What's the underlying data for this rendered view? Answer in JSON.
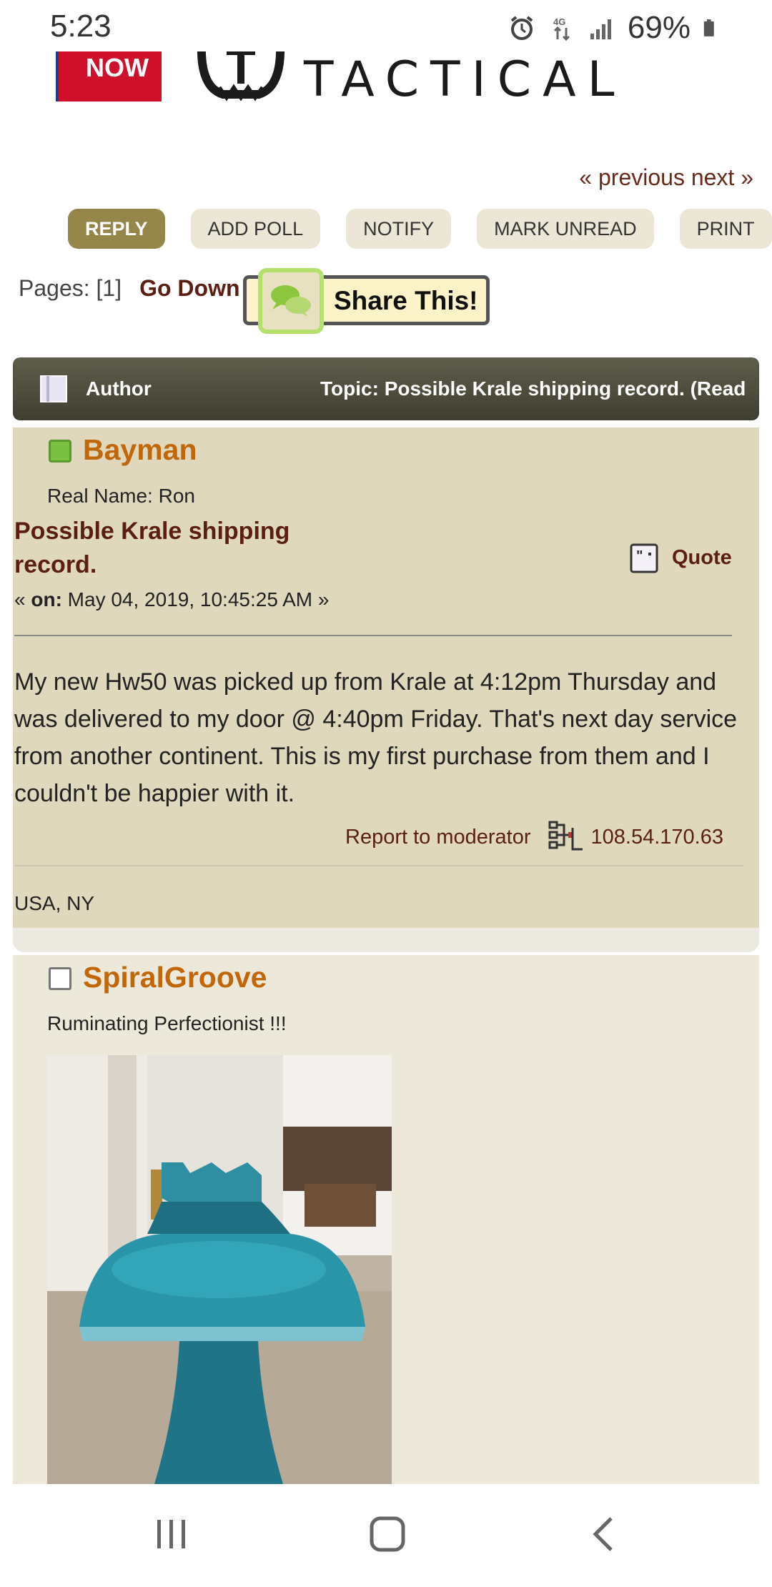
{
  "status_bar": {
    "time": "5:23",
    "battery": "69%",
    "icons": [
      "alarm-icon",
      "data-4g-icon",
      "signal-icon",
      "battery-icon"
    ]
  },
  "banner": {
    "ad_text": "NOW",
    "brand": "TACTICAL"
  },
  "topic_nav": {
    "prevnext": "« previous next »"
  },
  "buttons": {
    "reply": "REPLY",
    "add_poll": "ADD POLL",
    "notify": "NOTIFY",
    "mark_unread": "MARK UNREAD",
    "print": "PRINT"
  },
  "pages": {
    "label": "Pages: [1]",
    "go_down": "Go Down",
    "share": "Share This!"
  },
  "topic_header": {
    "author_label": "Author",
    "topic_title": "Topic: Possible Krale shipping record.  (Read"
  },
  "posts": [
    {
      "name": "Bayman",
      "status": "online",
      "real_name": "Real Name: Ron",
      "subject": "Possible Krale shipping record.",
      "quote_label": "Quote",
      "date_prefix": "« ",
      "date_on": "on:",
      "date_text": " May 04, 2019, 10:45:25 AM »",
      "body": "My new Hw50 was picked up from Krale at 4:12pm Thursday and was delivered to my door @ 4:40pm Friday.  That's next day service from another continent. This is my first purchase from them and I couldn't be happier with it.",
      "report": "Report to moderator",
      "ip": "108.54.170.63",
      "location": "USA,  NY"
    },
    {
      "name": "SpiralGroove",
      "status": "offline",
      "title": "Ruminating Perfectionist !!!"
    }
  ],
  "colors": {
    "accent_brown": "#5a1e12",
    "poster_orange": "#c0670a",
    "reply_button": "#948548",
    "post_bg_1": "#dfd8bd",
    "post_bg_2": "#ece8da"
  }
}
